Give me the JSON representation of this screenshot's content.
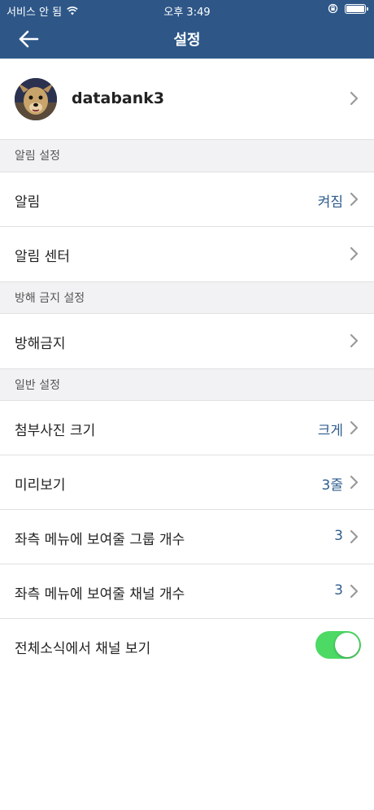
{
  "status_bar": {
    "carrier": "서비스 안 됨",
    "time": "오후 3:49"
  },
  "nav": {
    "title": "설정"
  },
  "profile": {
    "username": "databank3"
  },
  "sections": {
    "notifications": "알림 설정",
    "dnd": "방해 금지 설정",
    "general": "일반 설정"
  },
  "rows": {
    "notification": {
      "label": "알림",
      "value": "켜짐"
    },
    "notification_center": {
      "label": "알림 센터"
    },
    "dnd": {
      "label": "방해금지"
    },
    "attachment_size": {
      "label": "첨부사진 크기",
      "value": "크게"
    },
    "preview": {
      "label": "미리보기",
      "value": "3줄"
    },
    "group_count": {
      "label": "좌측 메뉴에 보여줄 그룹 개수",
      "value": "3"
    },
    "channel_count": {
      "label": "좌측 메뉴에 보여줄 채널 개수",
      "value": "3"
    },
    "all_news_channel": {
      "label": "전체소식에서 채널 보기",
      "enabled": true
    }
  },
  "colors": {
    "header": "#2e5788",
    "value_text": "#2f5d8e",
    "toggle_on": "#4cd964"
  }
}
